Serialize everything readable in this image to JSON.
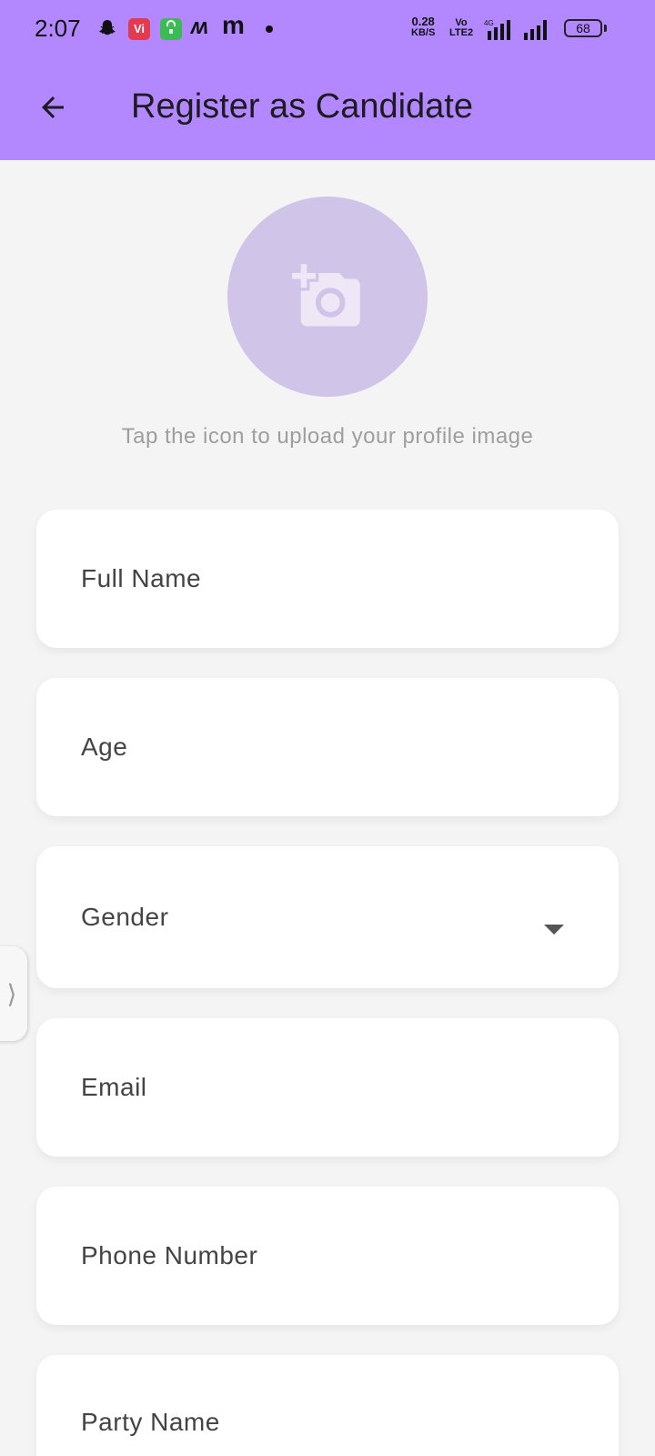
{
  "status_bar": {
    "time": "2:07",
    "vi_badge": "Vi",
    "speed_top": "0.28",
    "speed_bottom": "KB/S",
    "volte_top": "Vo",
    "volte_bottom": "LTE2",
    "network": "4G",
    "battery": "68",
    "icons": [
      "snapchat-icon",
      "vi-app-icon",
      "shopping-bag-icon",
      "myntra-icon",
      "m-app-icon",
      "notification-dot-icon",
      "signal-icon",
      "battery-icon"
    ],
    "background_color": "#b388ff"
  },
  "app_bar": {
    "title": "Register as Candidate",
    "back_icon": "arrow-back-icon",
    "background_color": "#b388ff"
  },
  "profile": {
    "upload_icon": "add-a-photo-icon",
    "hint": "Tap the icon to upload your profile image",
    "avatar_color": "#d1c4e9"
  },
  "form": {
    "full_name": {
      "label": "Full Name",
      "value": ""
    },
    "age": {
      "label": "Age",
      "value": ""
    },
    "gender": {
      "label": "Gender",
      "value": "",
      "icon": "arrow-drop-down-icon"
    },
    "email": {
      "label": "Email",
      "value": ""
    },
    "phone": {
      "label": "Phone Number",
      "value": ""
    },
    "party": {
      "label": "Party Name",
      "value": ""
    }
  },
  "side_handle": {
    "glyph": "⟩"
  }
}
